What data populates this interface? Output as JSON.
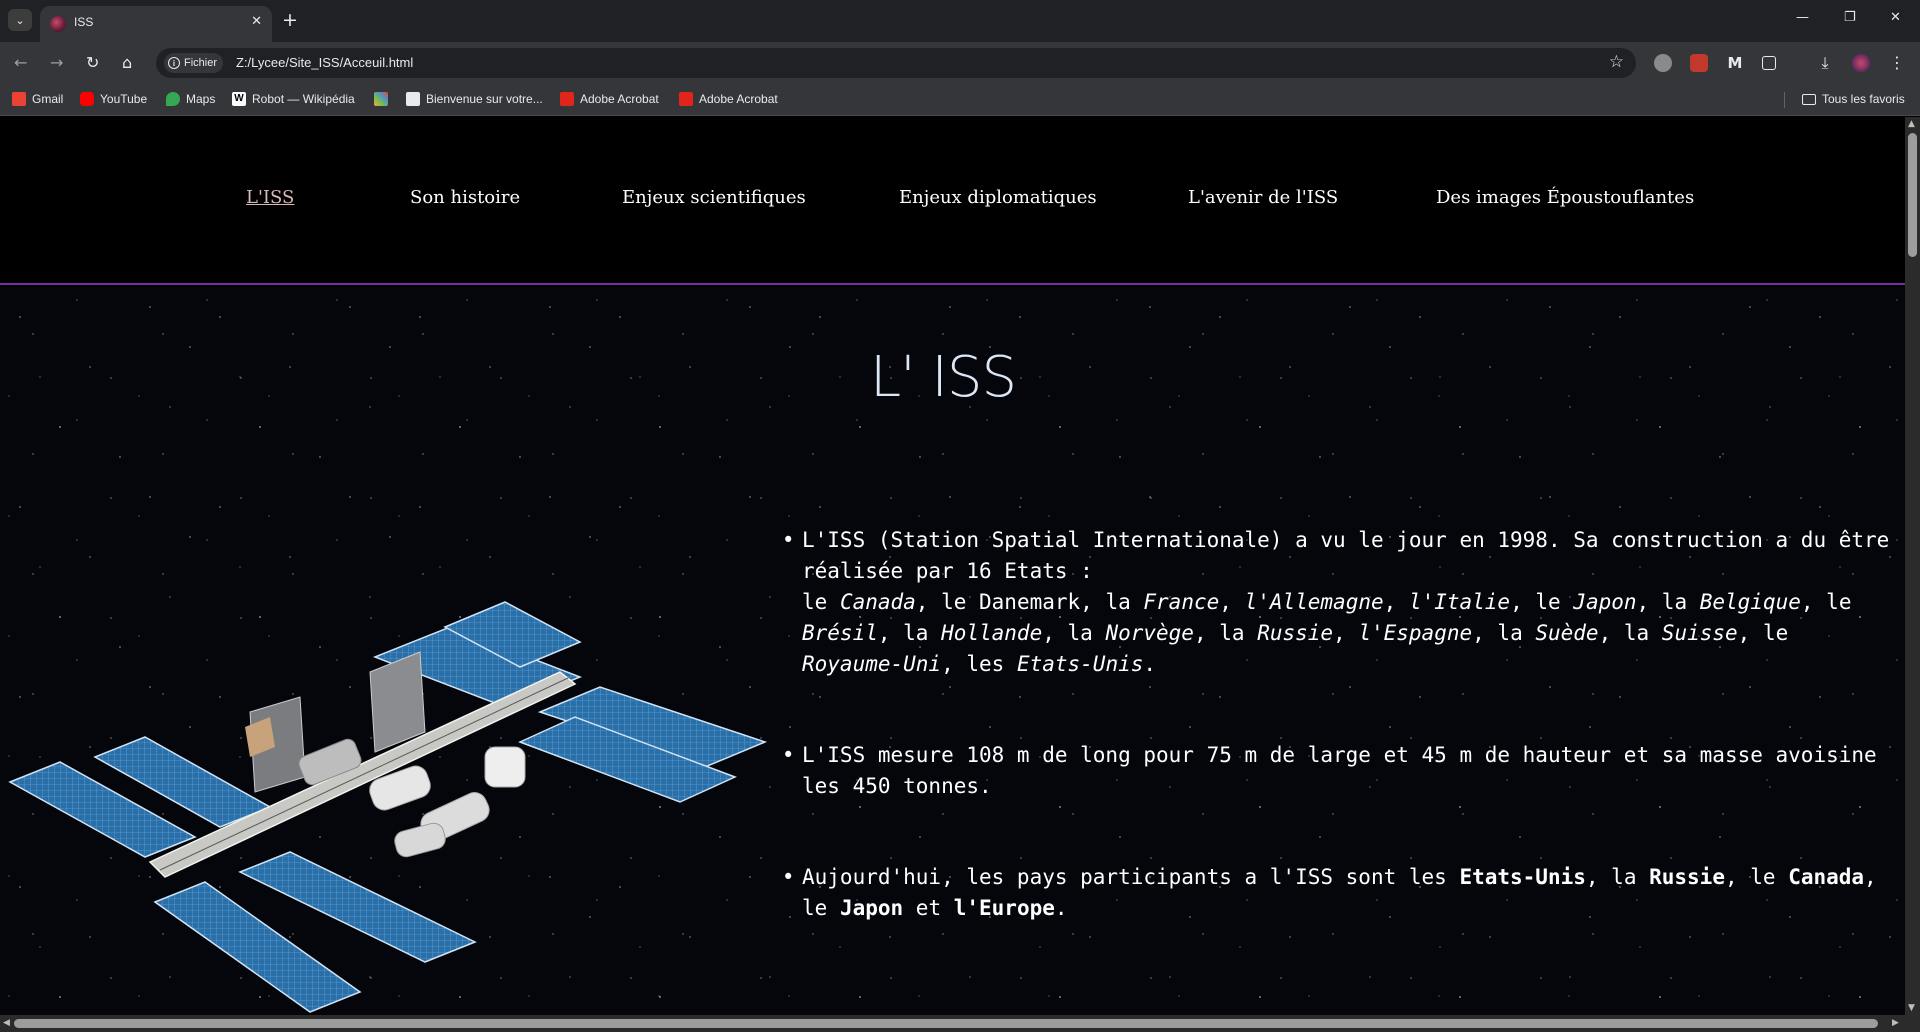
{
  "browser": {
    "tab_title": "ISS",
    "tab_close": "✕",
    "new_tab": "+",
    "site_chip": "Fichier",
    "url": "Z:/Lycee/Site_ISS/Acceuil.html",
    "window_controls": {
      "minimize": "—",
      "restore": "❐",
      "close": "✕"
    },
    "bookmarks": [
      {
        "label": "Gmail",
        "icon": "gmail-icon",
        "color": "#ea4335"
      },
      {
        "label": "YouTube",
        "icon": "youtube-icon",
        "color": "#ff0000"
      },
      {
        "label": "Maps",
        "icon": "maps-icon",
        "color": "#34a853"
      },
      {
        "label": "Robot — Wikipédia",
        "icon": "wikipedia-icon",
        "color": "#ffffff"
      },
      {
        "label": "",
        "icon": "joomla-icon",
        "color": "#f9a541"
      },
      {
        "label": "Bienvenue sur votre...",
        "icon": "site-icon",
        "color": "#e8eaed"
      },
      {
        "label": "Adobe Acrobat",
        "icon": "acrobat-icon",
        "color": "#e1251b"
      },
      {
        "label": "Adobe Acrobat",
        "icon": "acrobat-icon",
        "color": "#e1251b"
      }
    ],
    "all_bookmarks": "Tous les favoris"
  },
  "site": {
    "nav": [
      {
        "label": "L'ISS",
        "active": true
      },
      {
        "label": "Son histoire"
      },
      {
        "label": "Enjeux scientifiques"
      },
      {
        "label": "Enjeux diplomatiques"
      },
      {
        "label": "L'avenir de l'ISS"
      },
      {
        "label": "Des images Époustouflantes"
      }
    ],
    "title": "L' ISS",
    "facts": {
      "f1": {
        "intro": "L'ISS (Station Spatial Internationale) a vu le jour en 1998. Sa construction a du être réalisée par 16 Etats :",
        "countries": [
          "Canada",
          "Danemark",
          "France",
          "l'Allemagne",
          "l'Italie",
          "Japon",
          "Belgique",
          "Brésil",
          "Hollande",
          "Norvège",
          "Russie",
          "l'Espagne",
          "Suède",
          "Suisse",
          "Royaume-Uni",
          "Etats-Unis"
        ]
      },
      "f2": "L'ISS mesure 108 m de long pour 75 m de large et 45 m de hauteur et sa masse avoisine les 450 tonnes.",
      "f3": {
        "a": "Aujourd'hui, les pays participants a l'ISS sont les ",
        "b1": "Etats-Unis",
        "sep1": ", la ",
        "b2": "Russie",
        "sep2": ", le ",
        "b3": "Canada",
        "sep3": ", le ",
        "b4": "Japon",
        "sep4": " et ",
        "b5": "l'Europe",
        "end": "."
      }
    }
  },
  "colors": {
    "nav_divider": "#7a2aa8",
    "active_link": "#d9b8b8",
    "solar_panel": "#2a6fa8"
  }
}
